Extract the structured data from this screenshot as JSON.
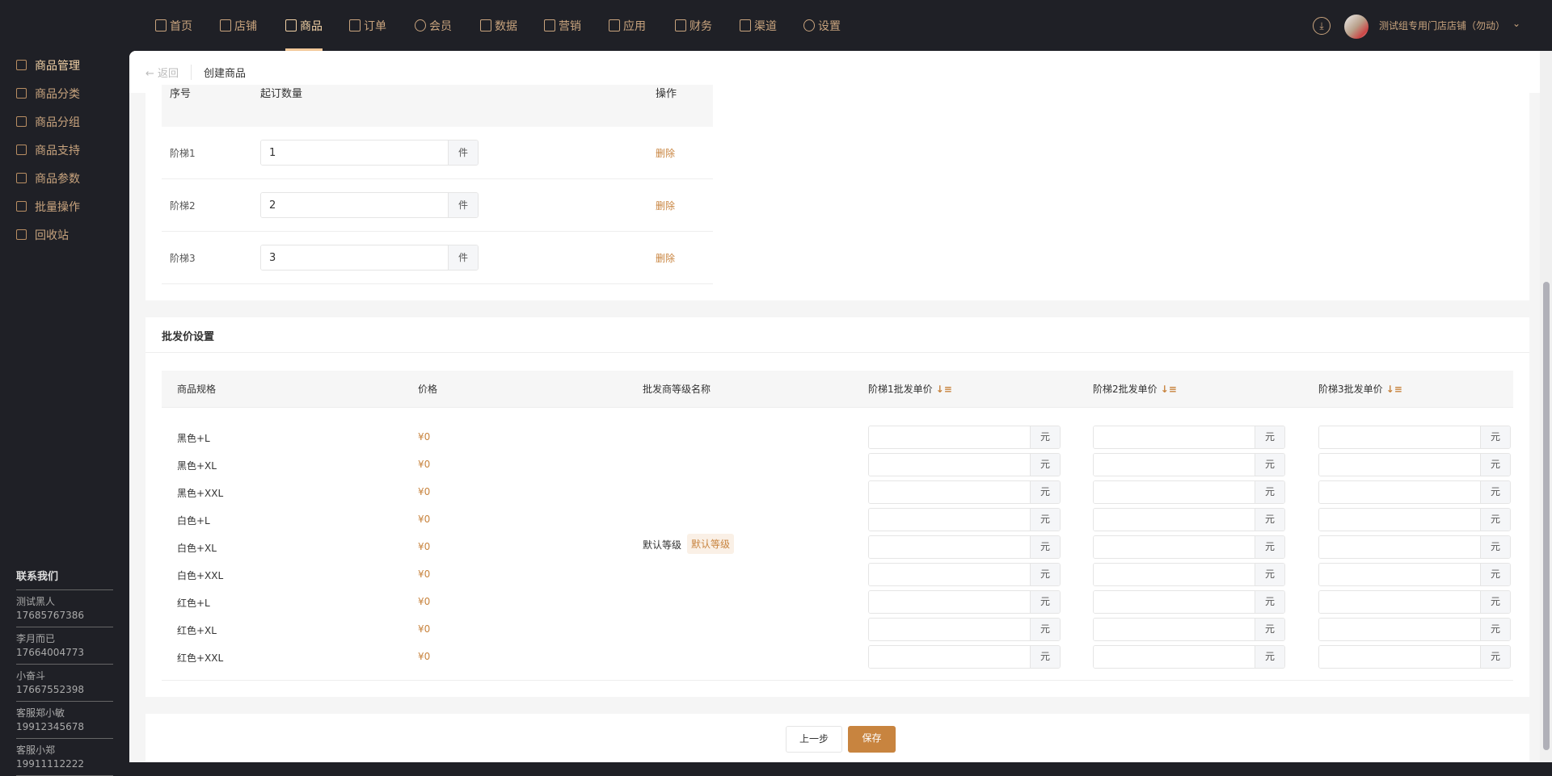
{
  "topnav": [
    {
      "label": "首页",
      "icon": "home-icon"
    },
    {
      "label": "店铺",
      "icon": "shop-icon"
    },
    {
      "label": "商品",
      "icon": "goods-icon",
      "active": true
    },
    {
      "label": "订单",
      "icon": "order-icon"
    },
    {
      "label": "会员",
      "icon": "member-icon"
    },
    {
      "label": "数据",
      "icon": "chart-icon"
    },
    {
      "label": "营销",
      "icon": "tag-icon"
    },
    {
      "label": "应用",
      "icon": "app-icon"
    },
    {
      "label": "财务",
      "icon": "finance-icon"
    },
    {
      "label": "渠道",
      "icon": "channel-icon"
    },
    {
      "label": "设置",
      "icon": "gear-icon"
    }
  ],
  "header": {
    "store_name": "测试组专用门店店铺（勿动）"
  },
  "sidebar": {
    "items": [
      {
        "label": "商品管理",
        "active": true
      },
      {
        "label": "商品分类"
      },
      {
        "label": "商品分组"
      },
      {
        "label": "商品支持"
      },
      {
        "label": "商品参数"
      },
      {
        "label": "批量操作"
      },
      {
        "label": "回收站"
      }
    ],
    "contact_title": "联系我们",
    "contacts": [
      {
        "name": "测试黑人",
        "phone": "17685767386"
      },
      {
        "name": "李月而已",
        "phone": "17664004773"
      },
      {
        "name": "小奋斗",
        "phone": "17667552398"
      },
      {
        "name": "客服郑小敏",
        "phone": "19912345678"
      },
      {
        "name": "客服小郑",
        "phone": "19911112222"
      }
    ]
  },
  "breadcrumb": {
    "back": "← 返回",
    "current": "创建商品"
  },
  "tiers": {
    "headers": [
      "序号",
      "起订数量",
      "操作"
    ],
    "unit": "件",
    "delete_label": "删除",
    "rows": [
      {
        "label": "阶梯1",
        "value": "1"
      },
      {
        "label": "阶梯2",
        "value": "2"
      },
      {
        "label": "阶梯3",
        "value": "3"
      }
    ]
  },
  "wholesale": {
    "title": "批发价设置",
    "headers": [
      "商品规格",
      "价格",
      "批发商等级名称",
      "阶梯1批发单价",
      "阶梯2批发单价",
      "阶梯3批发单价"
    ],
    "level_name": "默认等级",
    "level_tag": "默认等级",
    "unit": "元",
    "rows": [
      {
        "spec": "黑色+L",
        "price": "¥0"
      },
      {
        "spec": "黑色+XL",
        "price": "¥0"
      },
      {
        "spec": "黑色+XXL",
        "price": "¥0"
      },
      {
        "spec": "白色+L",
        "price": "¥0"
      },
      {
        "spec": "白色+XL",
        "price": "¥0"
      },
      {
        "spec": "白色+XXL",
        "price": "¥0"
      },
      {
        "spec": "红色+L",
        "price": "¥0"
      },
      {
        "spec": "红色+XL",
        "price": "¥0"
      },
      {
        "spec": "红色+XXL",
        "price": "¥0"
      }
    ]
  },
  "footer": {
    "prev": "上一步",
    "save": "保存"
  },
  "colors": {
    "accent": "#c8843f",
    "nav": "#c9a47e",
    "dark": "#1f2026"
  }
}
